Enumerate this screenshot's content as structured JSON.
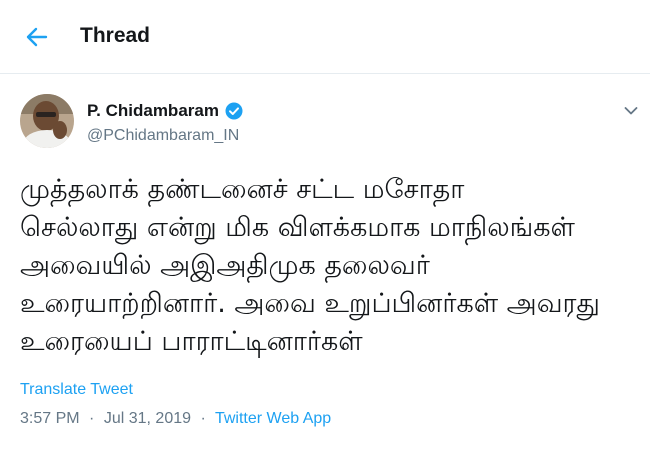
{
  "header": {
    "back_icon": "arrow-left-icon",
    "title": "Thread"
  },
  "tweet": {
    "author_name": "P. Chidambaram",
    "author_handle": "@PChidambaram_IN",
    "verified_icon": "verified-badge-icon",
    "menu_icon": "chevron-down-icon",
    "text": "முத்தலாக் தண்டனைச் சட்ட மசோதா\nசெல்லாது என்று மிக விளக்கமாக மாநிலங்கள்\nஅவையில் அஇஅதிமுக தலைவர்\nஉரையாற்றினார். அவை உறுப்பினர்கள் அவரது\nஉரையைப் பாராட்டினார்கள்",
    "translate_label": "Translate Tweet",
    "time": "3:57 PM",
    "separator": "·",
    "date": "Jul 31, 2019",
    "source": "Twitter Web App"
  },
  "colors": {
    "accent": "#1da1f2",
    "secondary_text": "#657786",
    "primary_text": "#14171a"
  }
}
